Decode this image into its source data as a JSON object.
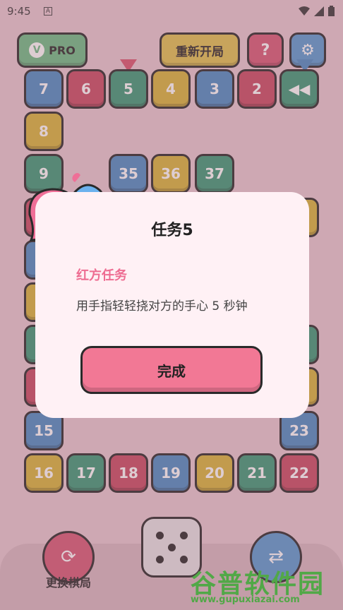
{
  "status_bar": {
    "time": "9:45",
    "notif_icon": "A"
  },
  "top_bar": {
    "pro_label": "PRO",
    "restart_label": "重新开局",
    "help_label": "?",
    "settings_icon": "gear-icon"
  },
  "tiles": {
    "t7": "7",
    "t6": "6",
    "t5": "5",
    "t4": "4",
    "t3": "3",
    "t2": "2",
    "t8": "8",
    "t9": "9",
    "t35": "35",
    "t36": "36",
    "t37": "37",
    "t15": "15",
    "t23": "23",
    "t16": "16",
    "t17": "17",
    "t18": "18",
    "t19": "19",
    "t20": "20",
    "t21": "21",
    "t22": "22"
  },
  "dialog": {
    "title": "任务5",
    "side_label": "红方任务",
    "task_text": "用手指轻轻挠对方的手心 5 秒钟",
    "done_label": "完成"
  },
  "bottom": {
    "swap_label": "更换棋局"
  },
  "watermark": {
    "title": "谷普软件园",
    "url": "www.gupuxiazai.com"
  }
}
